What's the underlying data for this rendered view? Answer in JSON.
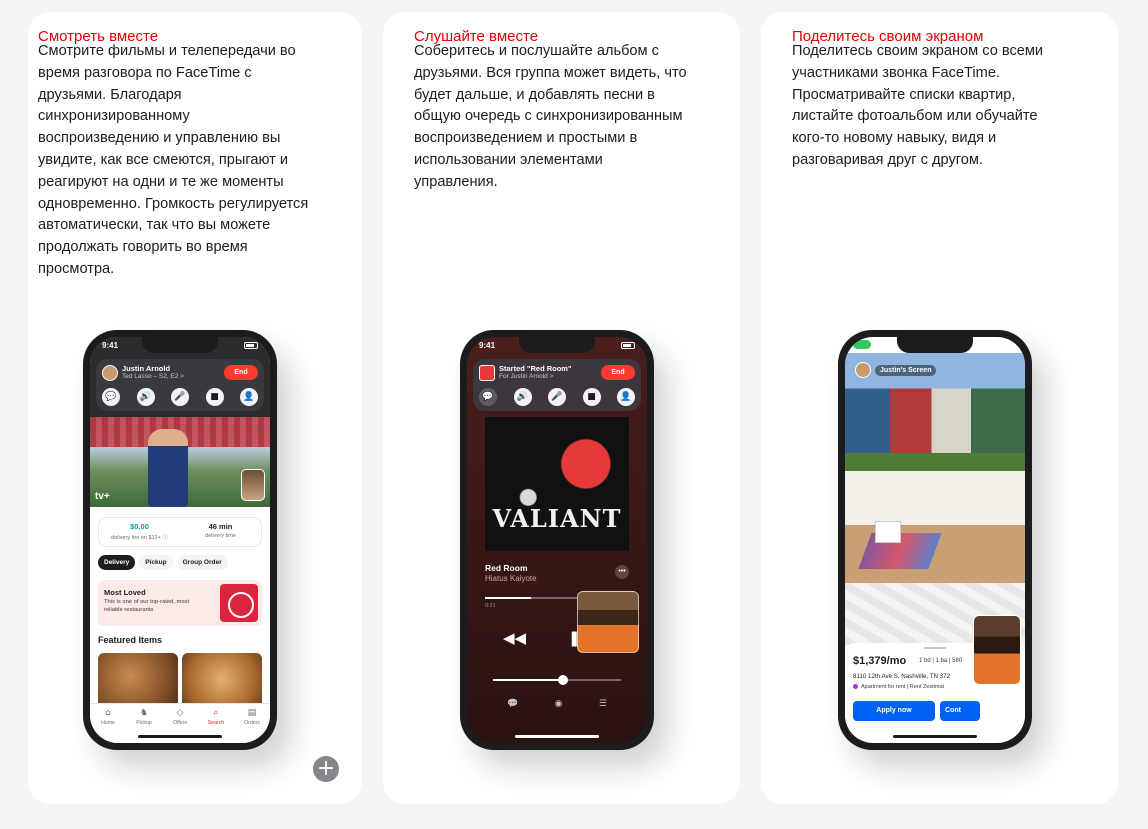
{
  "cards": [
    {
      "title": "Смотреть вместе",
      "lines": [
        "Смотрите фильмы и телепередачи во",
        "время разговора по FaceTime с",
        "друзьями. Благодаря",
        "синхронизированному",
        "воспроизведению и управлению вы",
        "увидите, как все смеются, прыгают и",
        "реагируют на одни и те же моменты",
        "одновременно. Громкость регулируется",
        "автоматически, так что вы можете",
        "продолжать говорить во время",
        "просмотра."
      ]
    },
    {
      "title": "Слушайте вместе",
      "lines": [
        "Соберитесь и послушайте альбом с",
        "друзьями. Вся группа может видеть, что",
        "будет дальше, и добавлять песни в",
        "общую очередь с синхронизированным",
        "воспроизведением и простыми в",
        "использовании элементами",
        "управления."
      ]
    },
    {
      "title": "Поделитесь своим экраном",
      "lines": [
        "Поделитесь своим экраном со всеми",
        "участниками звонка FaceTime.",
        "Просматривайте списки квартир,",
        "листайте фотоальбом или обучайте",
        "кого-то новому навыку, видя и",
        "разговаривая друг с другом."
      ]
    }
  ],
  "add_button": "+",
  "phone1": {
    "time": "9:41",
    "caller": "Justin Arnold",
    "caller_sub": "Ted Lasso – S2, E2 >",
    "end_label": "End",
    "controls": [
      "💬",
      "🔊",
      "🎤",
      "■",
      "👤"
    ],
    "video_logo": "tv+",
    "delivery_fee": "$0.00",
    "delivery_fee_label": "delivery fee on $12+ ⓘ",
    "delivery_time": "46 min",
    "delivery_time_label": "delivery time",
    "pills": [
      "Delivery",
      "Pickup",
      "Group Order"
    ],
    "promo_title": "Most Loved",
    "promo_desc": "This is one of our top-rated, most reliable restaurants",
    "featured": "Featured Items",
    "tabs": [
      {
        "icon": "⌂",
        "label": "Home"
      },
      {
        "icon": "♞",
        "label": "Pickup"
      },
      {
        "icon": "◇",
        "label": "Offers"
      },
      {
        "icon": "⌕",
        "label": "Search"
      },
      {
        "icon": "▤",
        "label": "Orders"
      }
    ],
    "active_tab": 3
  },
  "phone2": {
    "time": "9:41",
    "caller": "Started \"Red Room\"",
    "caller_sub": "For Justin Arnold >",
    "end_label": "End",
    "controls": [
      "💬",
      "🔊",
      "🎤",
      "■",
      "👤"
    ],
    "album_art_title": "VALIANT",
    "track": "Red Room",
    "artist": "Hiatus Kaiyote",
    "more": "•••",
    "progress": 0.42,
    "volume": 0.55,
    "elapsed": "0:21",
    "transport": [
      "◀◀",
      "❚❚"
    ],
    "bottom_icons": [
      "💬",
      "◉",
      "☰"
    ]
  },
  "phone3": {
    "sharer": "Justin's Screen",
    "price": "$1,379/mo",
    "specs": "1 bd | 1 ba | 580",
    "address": "8110 12th Ave S, Nashville, TN 372",
    "tag": "Apartment for rent | Rent Zestimat",
    "apply": "Apply now",
    "contact": "Cont"
  },
  "colors": {
    "title_red": "#e30000",
    "end_red": "#ff3b30",
    "apply_blue": "#0061f2",
    "doordash_red": "#e41b23"
  }
}
